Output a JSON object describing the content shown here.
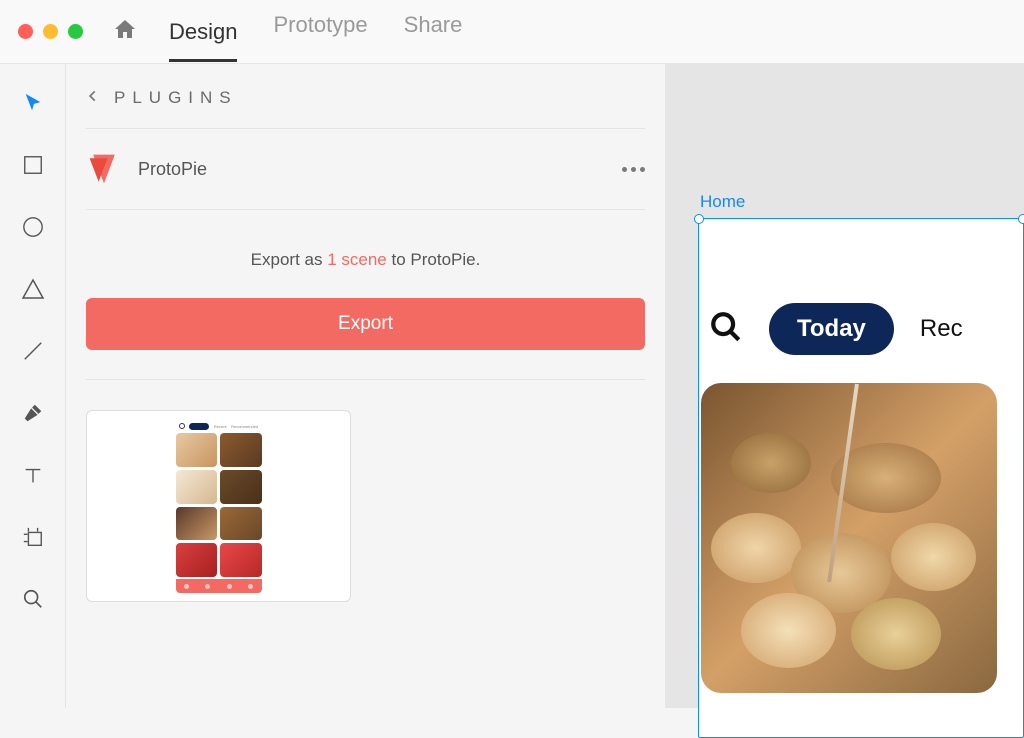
{
  "tabs": {
    "design": "Design",
    "prototype": "Prototype",
    "share": "Share"
  },
  "panel": {
    "title": "PLUGINS"
  },
  "plugin": {
    "name": "ProtoPie"
  },
  "export": {
    "prefix": "Export as ",
    "scene": "1 scene",
    "suffix": " to ProtoPie.",
    "button": "Export"
  },
  "thumb": {
    "pill": "Today",
    "tab1": "Recent",
    "tab2": "Recommended"
  },
  "canvas": {
    "label": "Home",
    "today": "Today",
    "recent": "Rec"
  }
}
